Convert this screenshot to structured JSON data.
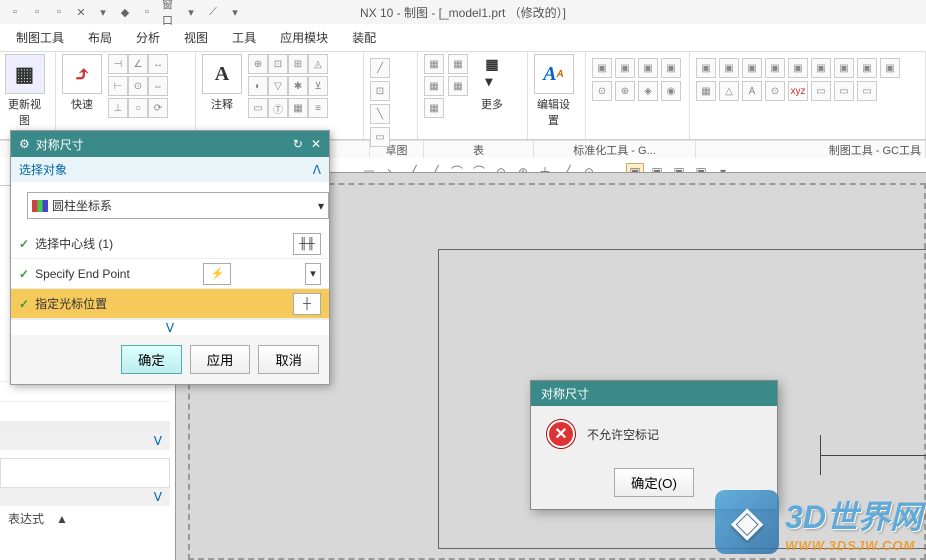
{
  "app": {
    "title": "NX 10 - 制图 - [_model1.prt （修改的）]",
    "window_menu": "窗口"
  },
  "menus": [
    "制图工具",
    "布局",
    "分析",
    "视图",
    "工具",
    "应用模块",
    "装配"
  ],
  "ribbon": {
    "big1_label": "更新视图",
    "big2_label": "快速",
    "big3_letter": "A",
    "big3_label": "注释",
    "big4_label": "更多",
    "big5_label": "编辑设置"
  },
  "group_labels": {
    "g1": "草图",
    "g2": "表",
    "g3": "标准化工具 - G...",
    "g4": "制图工具 - GC工具"
  },
  "dialog": {
    "title": "对称尺寸",
    "section": "选择对象",
    "csys": "圆柱坐标系",
    "row1": "选择中心线 (1)",
    "row2": "Specify End Point",
    "row3": "指定光标位置",
    "ok": "确定",
    "apply": "应用",
    "cancel": "取消"
  },
  "error": {
    "title": "对称尺寸",
    "message": "不允许空标记",
    "ok": "确定(O)"
  },
  "leftpanel": {
    "expr_label": "表达式"
  },
  "watermark": {
    "main": "3D世界网",
    "sub": "WWW.3DSJW.COM"
  }
}
